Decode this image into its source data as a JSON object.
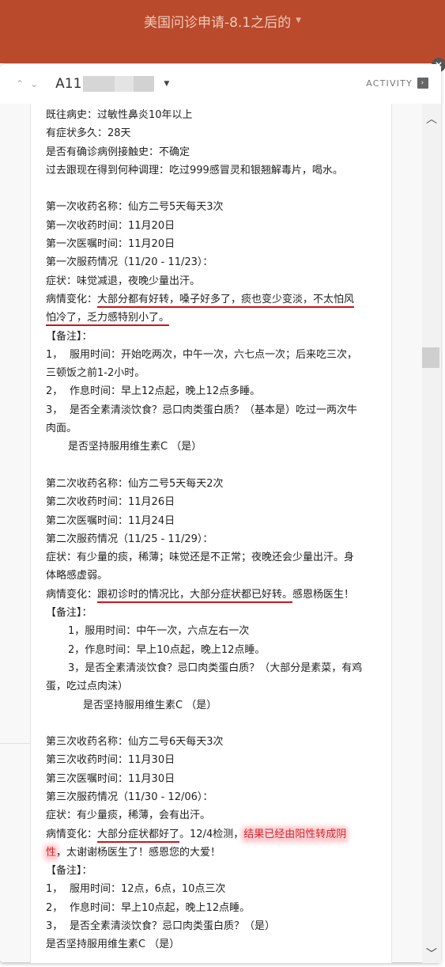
{
  "board": {
    "title": "美国问诊申请-8.1之后的"
  },
  "card": {
    "id_prefix": "A11",
    "activity_label": "ACTIVITY",
    "close_glyph": "×",
    "nav_up_glyph": "⌃",
    "nav_down_glyph": "⌄"
  },
  "icons": {
    "caret": "▼",
    "activity": "›",
    "scroll_up": "︿",
    "scroll_down": "﹀"
  },
  "content": {
    "history": [
      "既往病史：过敏性鼻炎10年以上",
      "有症状多久：28天",
      "是否有确诊病例接触史：不确定",
      "过去跟现在得到何种调理：吃过999感冒灵和银翘解毒片，喝水。"
    ],
    "first": {
      "name": "第一次收药名称：仙方二号5天每天3次",
      "received": "第一次收药时间：11月20日",
      "ordered": "第一次医嘱时间：11月20日",
      "status": "第一次服药情况（11/20 - 11/23）：",
      "symptoms": "症状：味觉减退，夜晚少量出汗。",
      "change_label": "病情变化：",
      "change_line1": "大部分都有好转，嗓子好多了，痰也变少变淡，不太怕风",
      "change_line2": "怕冷了，乏力感特别小了。",
      "notes_title": "【备注】：",
      "notes": [
        {
          "num": "1，",
          "text": "服用时间：开始吃两次，中午一次，六七点一次；后来吃三次，"
        },
        {
          "num": "",
          "text": "三顿饭之前1-2小时。"
        },
        {
          "num": "2，",
          "text": "作息时间：早上12点起，晚上12点多睡。"
        },
        {
          "num": "3，",
          "text": "是否全素清淡饮食？忌口肉类蛋白质？（基本是）吃过一两次牛"
        },
        {
          "num": "",
          "text": "肉面。"
        }
      ],
      "vitc": "是否坚持服用维生素C （是）"
    },
    "second": {
      "name": "第二次收药名称：仙方二号5天每天2次",
      "received": "第二次收药时间：11月26日",
      "ordered": "第二次医嘱时间：11月24日",
      "status": "第二次服药情况（11/25 - 11/29）：",
      "symptoms_line1": "症状：有少量的痰，稀薄；味觉还是不正常；夜晚还会少量出汗。身",
      "symptoms_line2": "体略感虚弱。",
      "change_label": "病情变化：",
      "change_underlined": "跟初诊时的情况比，大部分症状都已好转。",
      "change_rest": "感恩杨医生！",
      "notes_title": "【备注】：",
      "notes": [
        "1，服用时间：中午一次，六点左右一次",
        "2，作息时间：早上10点起，晚上12点睡。",
        "3，是否全素清淡饮食？忌口肉类蛋白质？（大部分是素菜，有鸡"
      ],
      "notes_cont": "蛋，吃过点肉沫）",
      "vitc": "是否坚持服用维生素C （是）"
    },
    "third": {
      "name": "第三次收药名称：仙方二号6天每天3次",
      "received": "第三次收药时间：11月30日",
      "ordered": "第三次医嘱时间：11月30日",
      "status": "第三次服药情况（11/30 - 12/06）：",
      "symptoms": "症状：有少量痰，稀薄，会有出汗。",
      "change_label": "病情变化：",
      "change_underlined": "大部分症状都好了",
      "change_mid": "。12/4检测，",
      "change_highlight1": "结果已经由阳性转成阴",
      "change_highlight2": "性",
      "change_rest": "，太谢谢杨医生了！感恩您的大爱！",
      "notes_title": "【备注】：",
      "notes": [
        {
          "num": "1，",
          "text": "服用时间：12点，6点，10点三次"
        },
        {
          "num": "2，",
          "text": "作息时间：早上10点起，晚上12点睡。"
        },
        {
          "num": "3，",
          "text": "是否全素清淡饮食？忌口肉类蛋白质？（是）"
        }
      ],
      "vitc": "是否坚持服用维生素C （是）"
    }
  },
  "colors": {
    "header_bg": "#b94a2c",
    "underline": "#c8161d",
    "highlight_text": "#d2242c"
  }
}
